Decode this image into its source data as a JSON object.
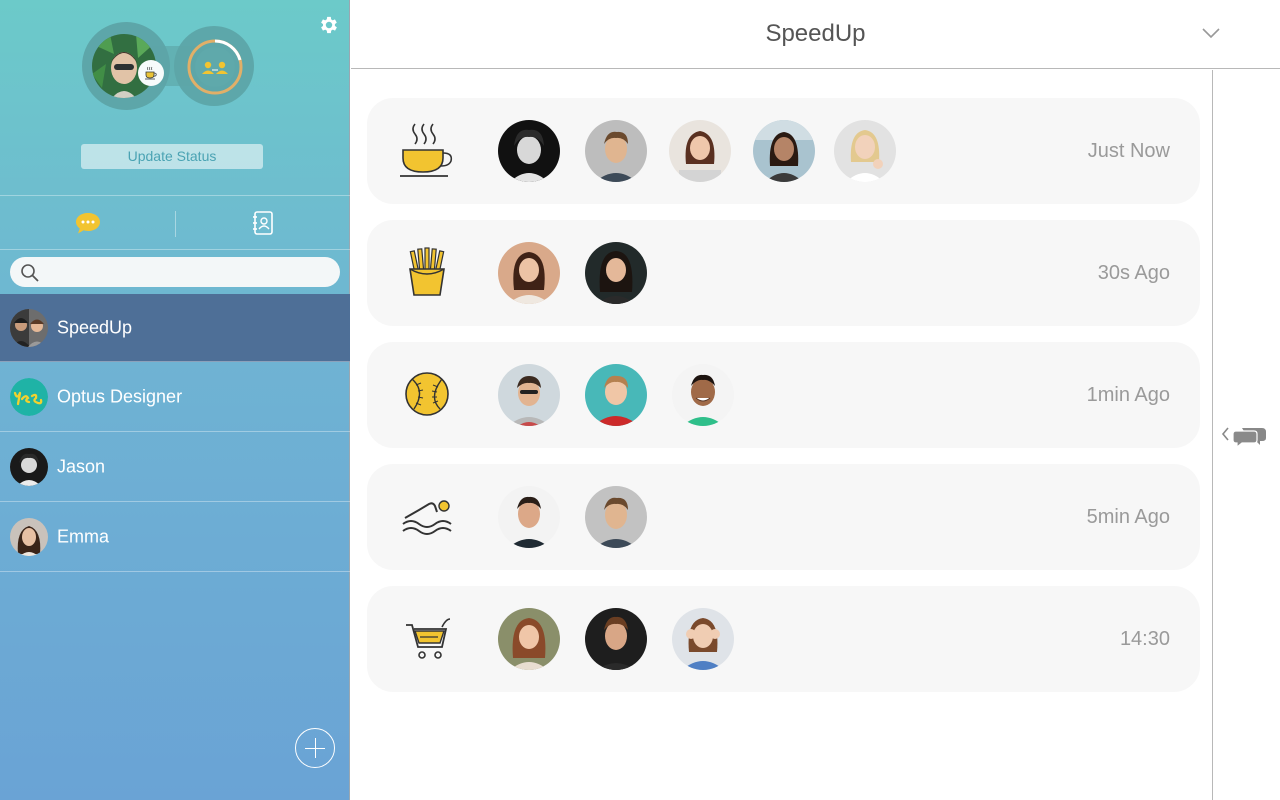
{
  "sidebar": {
    "settings_icon": "gear-icon",
    "update_status_label": "Update Status",
    "tabs": [
      {
        "name": "chats",
        "icon": "chat-bubble-icon",
        "active": true
      },
      {
        "name": "contacts",
        "icon": "address-book-icon",
        "active": false
      }
    ],
    "search": {
      "placeholder": "",
      "value": ""
    },
    "conversations": [
      {
        "name": "SpeedUp",
        "active": true,
        "avatar": "group-avatar"
      },
      {
        "name": "Optus Designer",
        "active": false,
        "avatar": "yes-logo-avatar"
      },
      {
        "name": "Jason",
        "active": false,
        "avatar": "person-avatar"
      },
      {
        "name": "Emma",
        "active": false,
        "avatar": "person-avatar"
      }
    ],
    "add_icon": "plus-circle-icon"
  },
  "header": {
    "title": "SpeedUp",
    "menu_icon": "chevron-down-icon"
  },
  "right_rail": {
    "toggle_icon": "chat-panel-toggle-icon"
  },
  "activities": [
    {
      "icon": "coffee-cup-icon",
      "members": 5,
      "time": "Just Now"
    },
    {
      "icon": "fries-icon",
      "members": 2,
      "time": "30s Ago"
    },
    {
      "icon": "softball-icon",
      "members": 3,
      "time": "1min Ago"
    },
    {
      "icon": "swimmer-icon",
      "members": 2,
      "time": "5min Ago"
    },
    {
      "icon": "shopping-cart-icon",
      "members": 3,
      "time": "14:30"
    }
  ],
  "colors": {
    "accent": "#f2c430",
    "active_row": "#4e6f97",
    "sidebar_top": "#6ccac9",
    "sidebar_bottom": "#6aa3d5"
  }
}
